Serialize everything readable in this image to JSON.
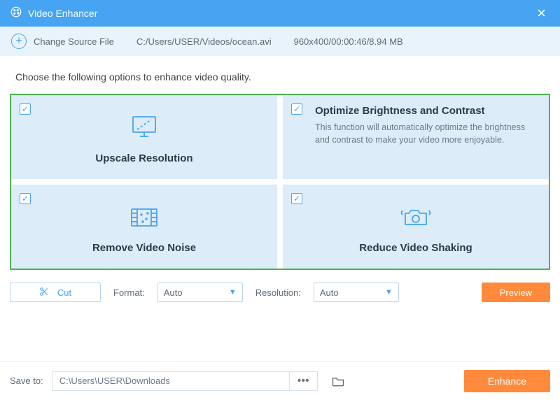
{
  "titlebar": {
    "title": "Video Enhancer"
  },
  "toolbar": {
    "change_source": "Change Source File",
    "file_path": "C:/Users/USER/Videos/ocean.avi",
    "file_info": "960x400/00:00:46/8.94 MB"
  },
  "instructions": "Choose the following options to enhance video quality.",
  "options": {
    "upscale": {
      "title": "Upscale Resolution"
    },
    "brightness": {
      "title": "Optimize Brightness and Contrast",
      "desc": "This function will automatically optimize the brightness and contrast to make your video more enjoyable."
    },
    "noise": {
      "title": "Remove Video Noise"
    },
    "shaking": {
      "title": "Reduce Video Shaking"
    }
  },
  "controls": {
    "cut": "Cut",
    "format_label": "Format:",
    "format_value": "Auto",
    "resolution_label": "Resolution:",
    "resolution_value": "Auto",
    "preview": "Preview"
  },
  "footer": {
    "save_label": "Save to:",
    "save_path": "C:\\Users\\USER\\Downloads",
    "enhance": "Enhance"
  }
}
